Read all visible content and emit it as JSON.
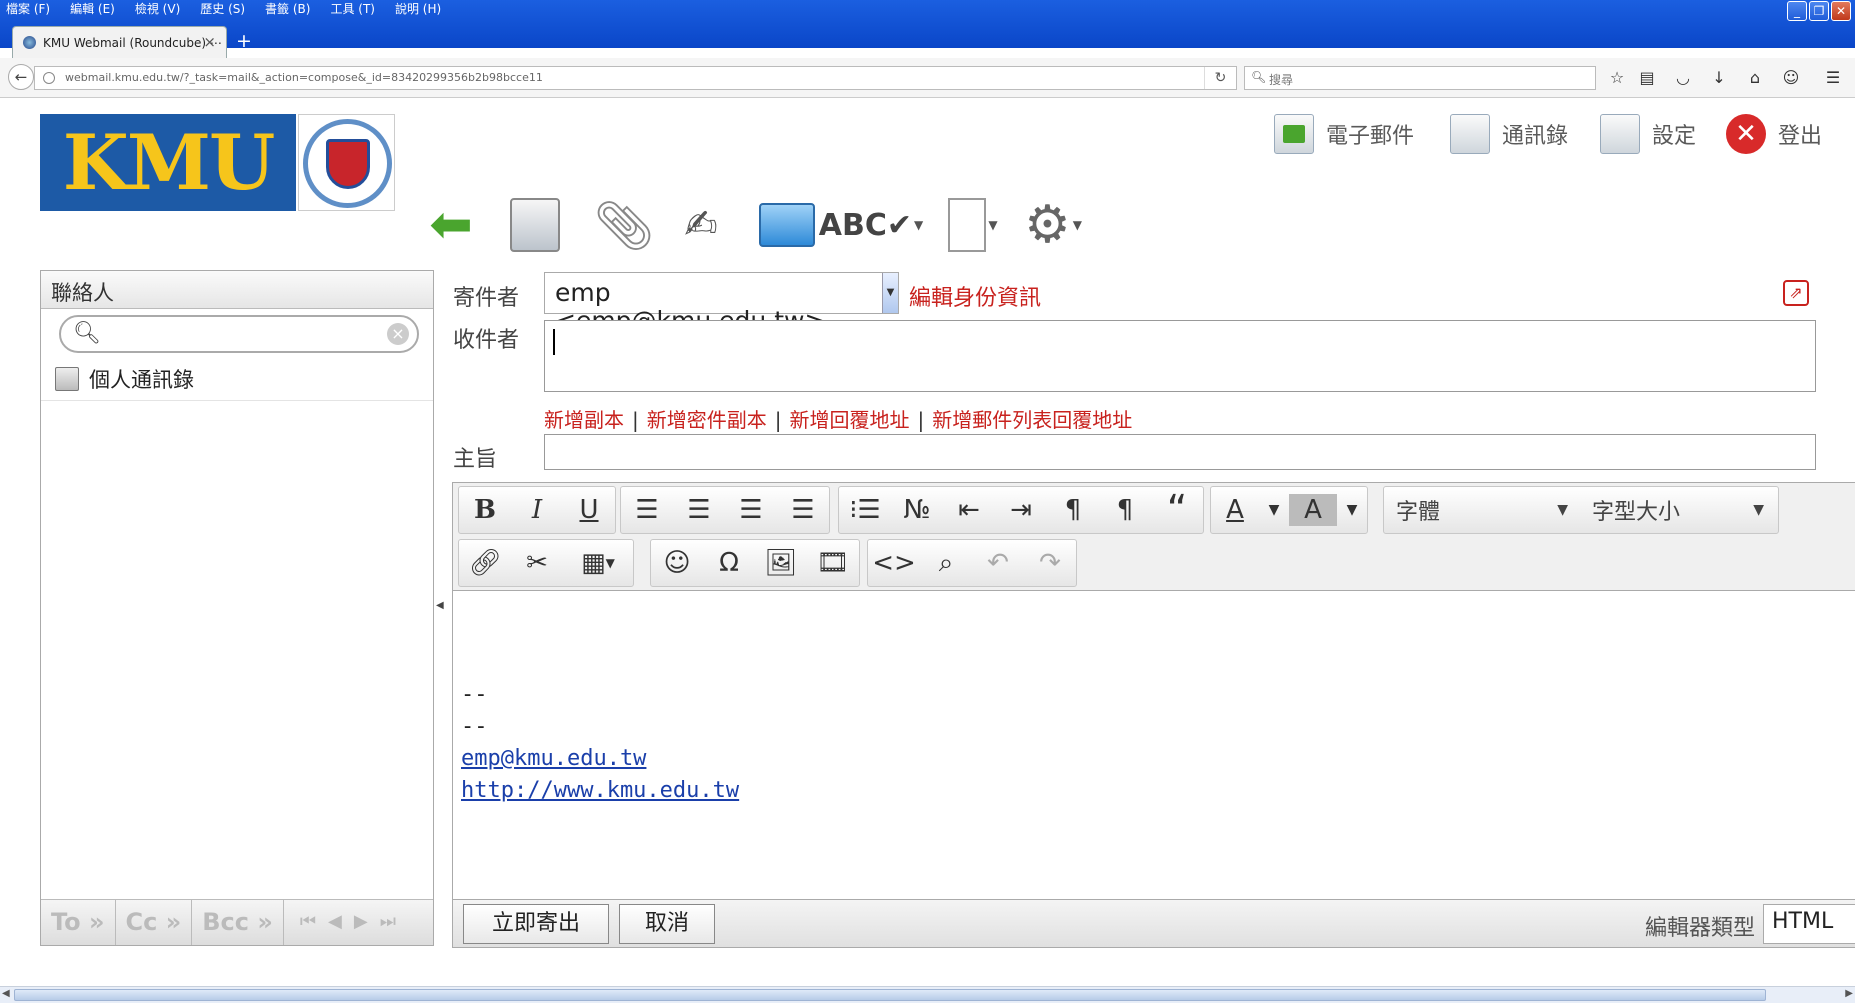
{
  "browser": {
    "menu": [
      "檔案 (F)",
      "編輯 (E)",
      "檢視 (V)",
      "歷史 (S)",
      "書籤 (B)",
      "工具 (T)",
      "說明 (H)"
    ],
    "tab_title": "KMU Webmail (Roundcube) ⋯",
    "url": "webmail.kmu.edu.tw/?_task=mail&_action=compose&_id=83420299356b2b98bcce11",
    "search_placeholder": "搜尋"
  },
  "header": {
    "logo_text": "KMU",
    "nav": [
      {
        "label": "電子郵件",
        "icon": "mail-icon"
      },
      {
        "label": "通訊錄",
        "icon": "addressbook-icon"
      },
      {
        "label": "設定",
        "icon": "settings-icon"
      },
      {
        "label": "登出",
        "icon": "logout-icon"
      }
    ]
  },
  "contacts": {
    "title": "聯絡人",
    "search_value": "",
    "addressbook_label": "個人通訊錄",
    "footer": {
      "to": "To »",
      "cc": "Cc »",
      "bcc": "Bcc »"
    }
  },
  "compose": {
    "from_label": "寄件者",
    "from_value": "emp <emp@kmu.edu.tw>",
    "edit_identity": "編輯身份資訊",
    "to_label": "收件者",
    "to_value": "",
    "add_links": [
      "新增副本",
      "新增密件副本",
      "新增回覆地址",
      "新增郵件列表回覆地址"
    ],
    "subject_label": "主旨",
    "subject_value": ""
  },
  "editor": {
    "font_family": "字體",
    "font_size": "字型大小",
    "body_lines": [
      "--",
      "--"
    ],
    "signature_email": "emp@kmu.edu.tw",
    "signature_url": "http://www.kmu.edu.tw",
    "send_button": "立即寄出",
    "cancel_button": "取消",
    "editor_type_label": "編輯器類型",
    "editor_type_value": "HTML"
  }
}
